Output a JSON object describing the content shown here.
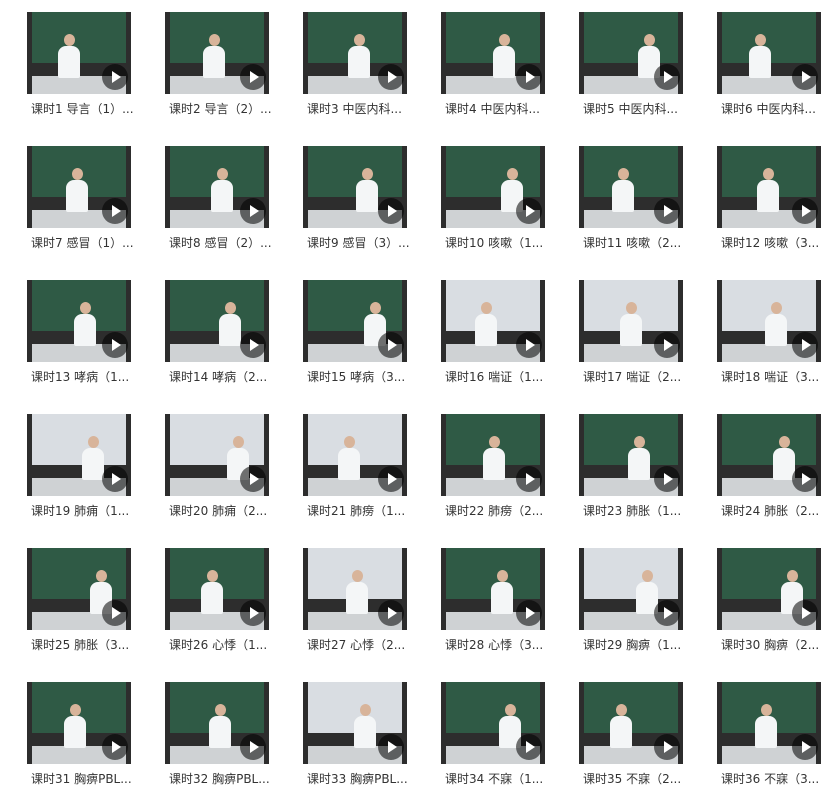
{
  "lessons": [
    {
      "title": "课时1 导言（1）..."
    },
    {
      "title": "课时2 导言（2）..."
    },
    {
      "title": "课时3 中医内科..."
    },
    {
      "title": "课时4 中医内科..."
    },
    {
      "title": "课时5 中医内科..."
    },
    {
      "title": "课时6 中医内科..."
    },
    {
      "title": "课时7 感冒（1）..."
    },
    {
      "title": "课时8 感冒（2）..."
    },
    {
      "title": "课时9 感冒（3）..."
    },
    {
      "title": "课时10 咳嗽（1..."
    },
    {
      "title": "课时11 咳嗽（2..."
    },
    {
      "title": "课时12 咳嗽（3..."
    },
    {
      "title": "课时13 哮病（1..."
    },
    {
      "title": "课时14 哮病（2..."
    },
    {
      "title": "课时15 哮病（3..."
    },
    {
      "title": "课时16 喘证（1..."
    },
    {
      "title": "课时17 喘证（2..."
    },
    {
      "title": "课时18 喘证（3..."
    },
    {
      "title": "课时19 肺痈（1..."
    },
    {
      "title": "课时20 肺痈（2..."
    },
    {
      "title": "课时21 肺痨（1..."
    },
    {
      "title": "课时22 肺痨（2..."
    },
    {
      "title": "课时23 肺胀（1..."
    },
    {
      "title": "课时24 肺胀（2..."
    },
    {
      "title": "课时25 肺胀（3..."
    },
    {
      "title": "课时26 心悸（1..."
    },
    {
      "title": "课时27 心悸（2..."
    },
    {
      "title": "课时28 心悸（3..."
    },
    {
      "title": "课时29 胸痹（1..."
    },
    {
      "title": "课时30 胸痹（2..."
    },
    {
      "title": "课时31 胸痹PBL..."
    },
    {
      "title": "课时32 胸痹PBL..."
    },
    {
      "title": "课时33 胸痹PBL..."
    },
    {
      "title": "课时34 不寐（1..."
    },
    {
      "title": "课时35 不寐（2..."
    },
    {
      "title": "课时36 不寐（3..."
    }
  ],
  "icons": {
    "play": "play-icon"
  },
  "colors": {
    "chalkboard": "#2f5a45",
    "projector": "#d9dde2",
    "text": "#333333"
  }
}
